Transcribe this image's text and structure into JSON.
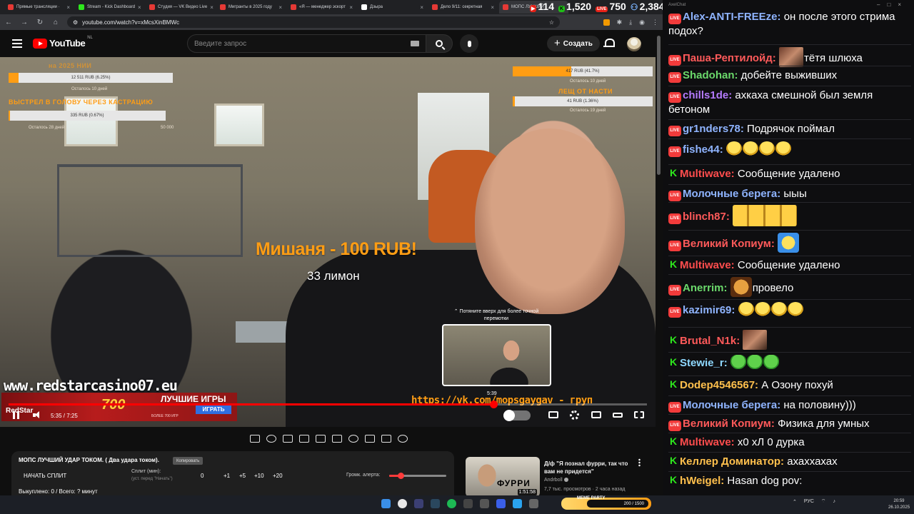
{
  "browser": {
    "tabs": [
      {
        "label": "Прямые трансляции ·",
        "color": "#e53935",
        "active": false
      },
      {
        "label": "Stream - Kick Dashboard",
        "color": "#2ee81d",
        "active": false
      },
      {
        "label": "Студия — VK Видео Live",
        "color": "#e53935",
        "active": false
      },
      {
        "label": "Мигранты в 2025 году",
        "color": "#e53935",
        "active": false
      },
      {
        "label": "«Я — менеджер эскорт",
        "color": "#e53935",
        "active": false
      },
      {
        "label": "Дзыра",
        "color": "#ffffff",
        "active": false
      },
      {
        "label": "Дело 9/11: секретная",
        "color": "#e53935",
        "active": false
      },
      {
        "label": "МОПС ЛУЧШИЙ",
        "color": "#e53935",
        "active": true
      }
    ],
    "url": "youtube.com/watch?v=xMcsXinBMWc",
    "stats": {
      "youtube": "114",
      "kick": "1,520",
      "vk": "750",
      "total": "2,384",
      "vk_badge": "LIVE"
    }
  },
  "youtube": {
    "logo_text": "YouTube",
    "logo_country": "NL",
    "search_placeholder": "Введите запрос",
    "create_label": "Создать",
    "create_plus": "+"
  },
  "overlay": {
    "left_top_title": "на 2025 НИИ",
    "left_bar1": {
      "text": "12 511 RUB (6.25%)",
      "fill": 0.0625,
      "caption": "Осталось 10 дней"
    },
    "left_title2": "ВЫСТРЕЛ В ГОЛОВУ ЧЕРЕЗ КАСТРАЦИЮ",
    "left_bar2": {
      "text": "335 RUB (0.67%)",
      "fill": 0.0067,
      "caption": "Осталось 28 дней",
      "goal": "50 000"
    },
    "right_bar1": {
      "text": "417 RUB (41.7%)",
      "fill": 0.417,
      "caption": "Осталось 10 дней"
    },
    "right_title": "ЛЕЩ ОТ НАСТИ",
    "right_bar2": {
      "text": "41 RUB (1.36%)",
      "fill": 0.0136,
      "caption": "Осталось 19 дней"
    },
    "donation_title": "Мишаня - 100 RUB!",
    "donation_message": "33 лимон",
    "watermark": "www.redstarcasino07.eu",
    "vk_link": "https://vk.com/mopsgaygav - груп",
    "ad": {
      "brand": "RedStar",
      "big": "ЛУЧШИЕ ИГРЫ",
      "sub": "БОЛЕЕ 700 ИГР",
      "button": "ИГРАТЬ",
      "number": "700"
    }
  },
  "player": {
    "seek_hint": "⌃ Потяните вверх для более точной перемотки",
    "preview_time": "5:39",
    "current_time": "5:35",
    "total_time": "7:25",
    "timecode": "5:35 / 7:25",
    "progress": 0.754,
    "hover": 0.76
  },
  "panel": {
    "title": "МОПС ЛУЧШИЙ УДАР ТОКОМ. ( Два удара током).",
    "copy_button": "Копировать",
    "split_button": "НАЧАТЬ СПЛИТ",
    "split_label": "Сплит (мин):",
    "split_hint": "(уст. перед \"Начать\")",
    "split_value": "0",
    "increments": [
      "+1",
      "+5",
      "+10",
      "+20"
    ],
    "alert_label": "Громк. алерта:",
    "alert_volume": 0.2,
    "footer": "Выкуплено: 0 / Всего: ? минут"
  },
  "recommendation": {
    "title": "Д/ф \"Я познал фурри, так что вам не придется\"",
    "channel": "Andrboll",
    "views": "7,7 тыс. просмотров",
    "age": "2 часа назад",
    "duration": "1:51:58",
    "thumb_word": "ФУРРИ"
  },
  "chat": {
    "window_title": "AxelChat",
    "messages": [
      {
        "platform": "yt",
        "nick": "Alex-ANTI-FREEze:",
        "color": "#8fb4ff",
        "text": "он после этого стрима подох?",
        "emotes": []
      },
      {
        "platform": "yt",
        "nick": "Паша-Рептилойд:",
        "color": "#ff5a5a",
        "text": "тётя шлюха",
        "emotes": [
          "photo"
        ]
      },
      {
        "platform": "yt",
        "nick": "Shadohan:",
        "color": "#6bd96b",
        "text": "добейте выживших",
        "emotes": []
      },
      {
        "platform": "yt",
        "nick": "chills1de:",
        "color": "#b57bff",
        "text": "ахкаха смешной был земля бетоном",
        "emotes": []
      },
      {
        "platform": "yt",
        "nick": "gr1nders78:",
        "color": "#8fb4ff",
        "text": "Подрячок поймал",
        "emotes": []
      },
      {
        "platform": "yt",
        "nick": "fishe44:",
        "color": "#8fb4ff",
        "text": "",
        "emotes": [
          "em",
          "em",
          "em",
          "em"
        ]
      },
      {
        "platform": "kick",
        "nick": "Multiwave:",
        "color": "#ff4d4d",
        "text": "Сообщение удалено",
        "emotes": []
      },
      {
        "platform": "yt",
        "nick": "Молочные берега:",
        "color": "#8fb4ff",
        "text": "ыыы",
        "emotes": []
      },
      {
        "platform": "yt",
        "nick": "blinch87:",
        "color": "#ff5a5a",
        "text": "",
        "emotes": [
          "wide"
        ]
      },
      {
        "platform": "yt",
        "nick": "Великий Копиум:",
        "color": "#ff5a5a",
        "text": "",
        "emotes": [
          "blue"
        ]
      },
      {
        "platform": "kick",
        "nick": "Multiwave:",
        "color": "#ff4d4d",
        "text": "Сообщение удалено",
        "emotes": []
      },
      {
        "platform": "yt",
        "nick": "Anerrim:",
        "color": "#6bd96b",
        "text": "провело",
        "emotes": [
          "dog"
        ]
      },
      {
        "platform": "yt",
        "nick": "kazimir69:",
        "color": "#8fb4ff",
        "text": "",
        "emotes": [
          "em",
          "em",
          "em",
          "em"
        ]
      },
      {
        "platform": "kick",
        "nick": "Brutal_N1k:",
        "color": "#ff5a5a",
        "text": "",
        "emotes": [
          "photo"
        ]
      },
      {
        "platform": "kick",
        "nick": "Stewie_r:",
        "color": "#8fd8ff",
        "text": "",
        "emotes": [
          "pepe",
          "pepe",
          "pepe"
        ]
      },
      {
        "platform": "kick",
        "nick": "Dodep4546567:",
        "color": "#ffc04d",
        "text": "А Озону похуй",
        "emotes": []
      },
      {
        "platform": "yt",
        "nick": "Молочные берега:",
        "color": "#8fb4ff",
        "text": "на половину)))",
        "emotes": []
      },
      {
        "platform": "yt",
        "nick": "Великий Копиум:",
        "color": "#ff5a5a",
        "text": "Физика для умных",
        "emotes": []
      },
      {
        "platform": "kick",
        "nick": "Multiwave:",
        "color": "#ff4d4d",
        "text": "х0 хЛ 0 дурка",
        "emotes": []
      },
      {
        "platform": "kick",
        "nick": "Келлер Доминатор:",
        "color": "#ffc04d",
        "text": "ахаххахах",
        "emotes": []
      },
      {
        "platform": "kick",
        "nick": "hWeigel:",
        "color": "#ffc04d",
        "text": "Hasan dog pov:",
        "emotes": []
      }
    ]
  },
  "taskbar": {
    "badge_title": "MEME PARTY",
    "badge_value": "200 / 1500",
    "language": "РУС",
    "time": "20:59",
    "date": "26.10.2025"
  }
}
